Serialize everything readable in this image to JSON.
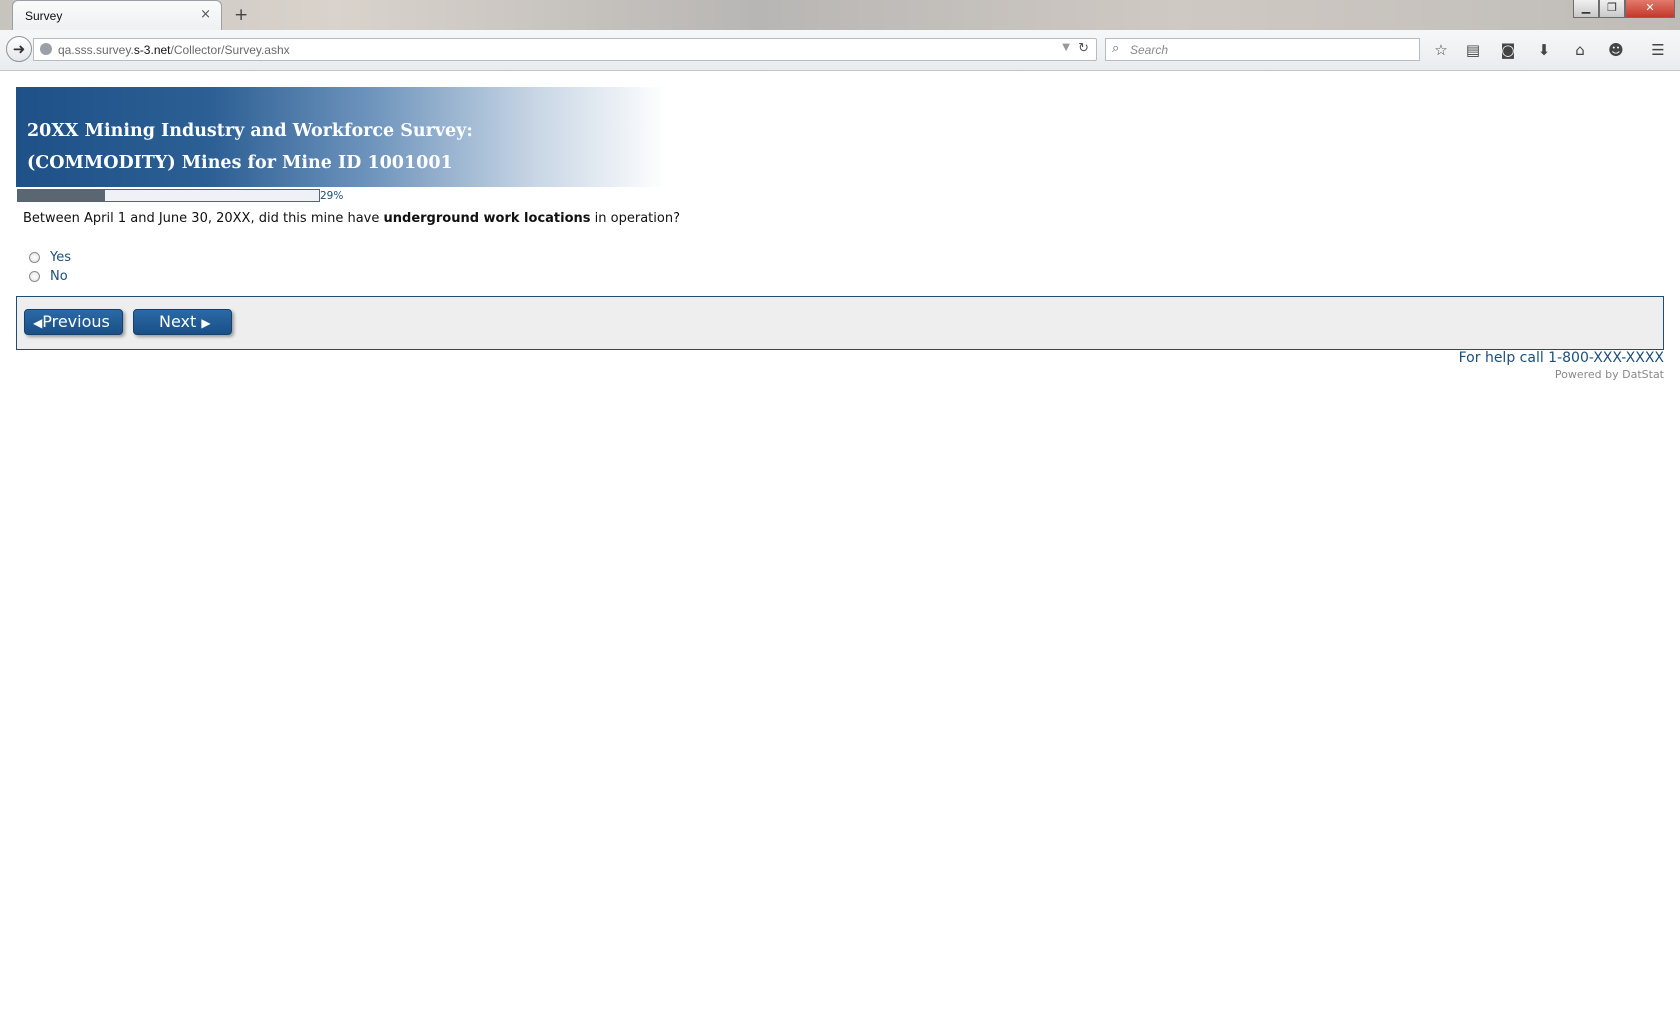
{
  "browser": {
    "tab_title": "Survey",
    "tab_close": "×",
    "new_tab": "+",
    "url_prefix": "qa.sss.survey.",
    "url_domain": "s-3.net",
    "url_path": "/Collector/Survey.ashx",
    "search_placeholder": "Search",
    "icons": [
      "back-icon",
      "reload-icon",
      "search-icon",
      "bookmark-star-icon",
      "reading-list-icon",
      "pocket-icon",
      "download-icon",
      "home-icon",
      "chat-icon",
      "menu-icon"
    ]
  },
  "survey": {
    "title_line1": "20XX Mining Industry and Workforce Survey:",
    "title_line2": "(COMMODITY) Mines for Mine ID 1001001",
    "progress_percent": 29,
    "progress_label": "29%",
    "question_before": "Between April 1 and June 30, 20XX, did this mine have ",
    "question_bold": "underground work locations",
    "question_after": " in operation?",
    "options": [
      {
        "label": "Yes",
        "selected": false
      },
      {
        "label": "No",
        "selected": false
      }
    ],
    "previous_label": "Previous",
    "next_label": "Next",
    "help_text": "For help call 1-800-XXX-XXXX",
    "powered_by": "Powered by DatStat"
  },
  "colors": {
    "brand_blue": "#1e5187",
    "link_blue": "#1b4f7c",
    "panel_gray": "#eeeeee"
  }
}
